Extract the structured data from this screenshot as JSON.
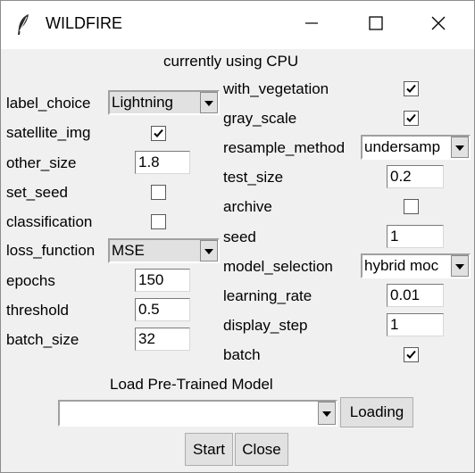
{
  "window": {
    "title": "WILDFIRE",
    "icons": {
      "app": "feather-icon",
      "minimize": "minimize-icon",
      "maximize": "maximize-icon",
      "close": "close-icon"
    }
  },
  "status": "currently using CPU",
  "left": {
    "label_choice": {
      "label": "label_choice",
      "value": "Lightning"
    },
    "satellite_img": {
      "label": "satellite_img",
      "checked": true
    },
    "other_size": {
      "label": "other_size",
      "value": "1.8"
    },
    "set_seed": {
      "label": "set_seed",
      "checked": false
    },
    "classification": {
      "label": "classification",
      "checked": false
    },
    "loss_function": {
      "label": "loss_function",
      "value": "MSE"
    },
    "epochs": {
      "label": "epochs",
      "value": "150"
    },
    "threshold": {
      "label": "threshold",
      "value": "0.5"
    },
    "batch_size": {
      "label": "batch_size",
      "value": "32"
    }
  },
  "right": {
    "with_vegetation": {
      "label": "with_vegetation",
      "checked": true
    },
    "gray_scale": {
      "label": "gray_scale",
      "checked": true
    },
    "resample_method": {
      "label": "resample_method",
      "value": "undersamp"
    },
    "test_size": {
      "label": "test_size",
      "value": "0.2"
    },
    "archive": {
      "label": "archive",
      "checked": false
    },
    "seed": {
      "label": "seed",
      "value": "1"
    },
    "model_selection": {
      "label": "model_selection",
      "value": "hybrid moc"
    },
    "learning_rate": {
      "label": "learning_rate",
      "value": "0.01"
    },
    "display_step": {
      "label": "display_step",
      "value": "1"
    },
    "batch": {
      "label": "batch",
      "checked": true
    }
  },
  "model_loader": {
    "label": "Load Pre-Trained Model",
    "value": "",
    "button": "Loading"
  },
  "actions": {
    "start": "Start",
    "close": "Close"
  }
}
